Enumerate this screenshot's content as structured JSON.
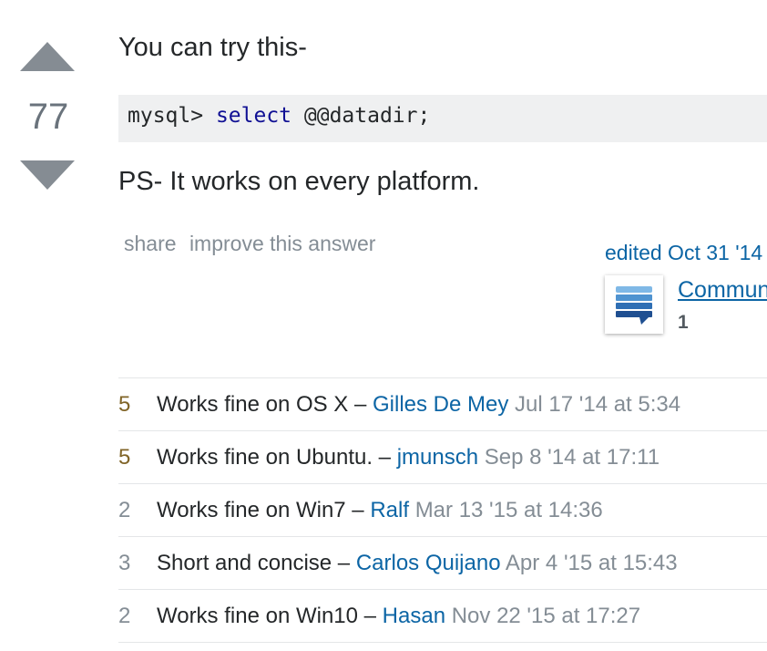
{
  "vote": {
    "count": "77",
    "up_icon": "triangle-up",
    "down_icon": "triangle-down"
  },
  "post": {
    "intro": "You can try this-",
    "code": {
      "prompt": "mysql> ",
      "keyword": "select",
      "rest": " @@datadir;"
    },
    "note": "PS- It works on every platform."
  },
  "menu": {
    "share": "share",
    "improve": "improve this answer"
  },
  "edit": {
    "label": "edited Oct 31 '14",
    "user": "Community",
    "reputation": "1",
    "avatar_icon": "community-wiki-icon"
  },
  "comments": [
    {
      "score": "5",
      "text": "Works fine on OS X",
      "user": "Gilles De Mey",
      "date": "Jul 17 '14 at 5:34",
      "hot": true
    },
    {
      "score": "5",
      "text": "Works fine on Ubuntu.",
      "user": "jmunsch",
      "date": "Sep 8 '14 at 17:11",
      "hot": true
    },
    {
      "score": "2",
      "text": "Works fine on Win7",
      "user": "Ralf",
      "date": "Mar 13 '15 at 14:36",
      "hot": false
    },
    {
      "score": "3",
      "text": "Short and concise",
      "user": "Carlos Quijano",
      "date": "Apr 4 '15 at 15:43",
      "hot": false
    },
    {
      "score": "2",
      "text": "Works fine on Win10",
      "user": "Hasan",
      "date": "Nov 22 '15 at 17:27",
      "hot": false
    }
  ],
  "colors": {
    "link": "#0c65a5",
    "hot_score": "#806427",
    "muted": "#848d95",
    "code_bg": "#eff0f1",
    "code_keyword": "#101094",
    "arrow": "#858c93"
  }
}
